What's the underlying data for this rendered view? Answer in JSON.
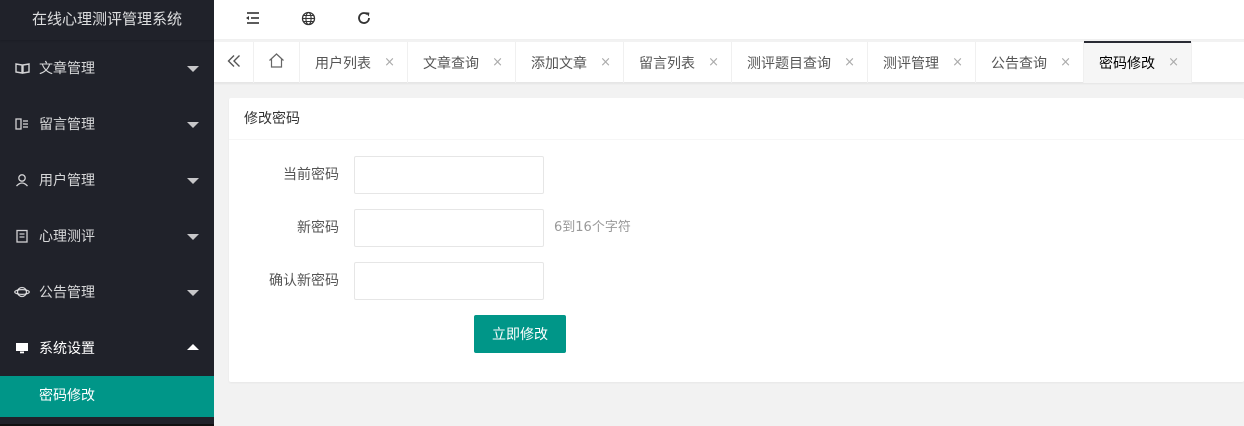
{
  "app": {
    "title": "在线心理测评管理系统"
  },
  "sidebar": {
    "items": [
      {
        "label": "文章管理",
        "icon": "book-icon",
        "expanded": false
      },
      {
        "label": "留言管理",
        "icon": "message-board-icon",
        "expanded": false
      },
      {
        "label": "用户管理",
        "icon": "user-icon",
        "expanded": false
      },
      {
        "label": "心理测评",
        "icon": "clipboard-icon",
        "expanded": false
      },
      {
        "label": "公告管理",
        "icon": "planet-icon",
        "expanded": false
      },
      {
        "label": "系统设置",
        "icon": "monitor-icon",
        "expanded": true
      }
    ],
    "subitems": [
      {
        "label": "密码修改",
        "active": true
      }
    ],
    "active_color": "#009688"
  },
  "header": {
    "icons": [
      "shrink-menu-icon",
      "globe-icon",
      "refresh-icon"
    ]
  },
  "tabs": {
    "items": [
      {
        "label": "用户列表",
        "active": false
      },
      {
        "label": "文章查询",
        "active": false
      },
      {
        "label": "添加文章",
        "active": false
      },
      {
        "label": "留言列表",
        "active": false
      },
      {
        "label": "测评题目查询",
        "active": false
      },
      {
        "label": "测评管理",
        "active": false
      },
      {
        "label": "公告查询",
        "active": false
      },
      {
        "label": "密码修改",
        "active": true
      }
    ],
    "close_glyph": "×"
  },
  "form": {
    "title": "修改密码",
    "fields": [
      {
        "label": "当前密码",
        "value": "",
        "hint": ""
      },
      {
        "label": "新密码",
        "value": "",
        "hint": "6到16个字符"
      },
      {
        "label": "确认新密码",
        "value": "",
        "hint": ""
      }
    ],
    "submit_label": "立即修改"
  }
}
